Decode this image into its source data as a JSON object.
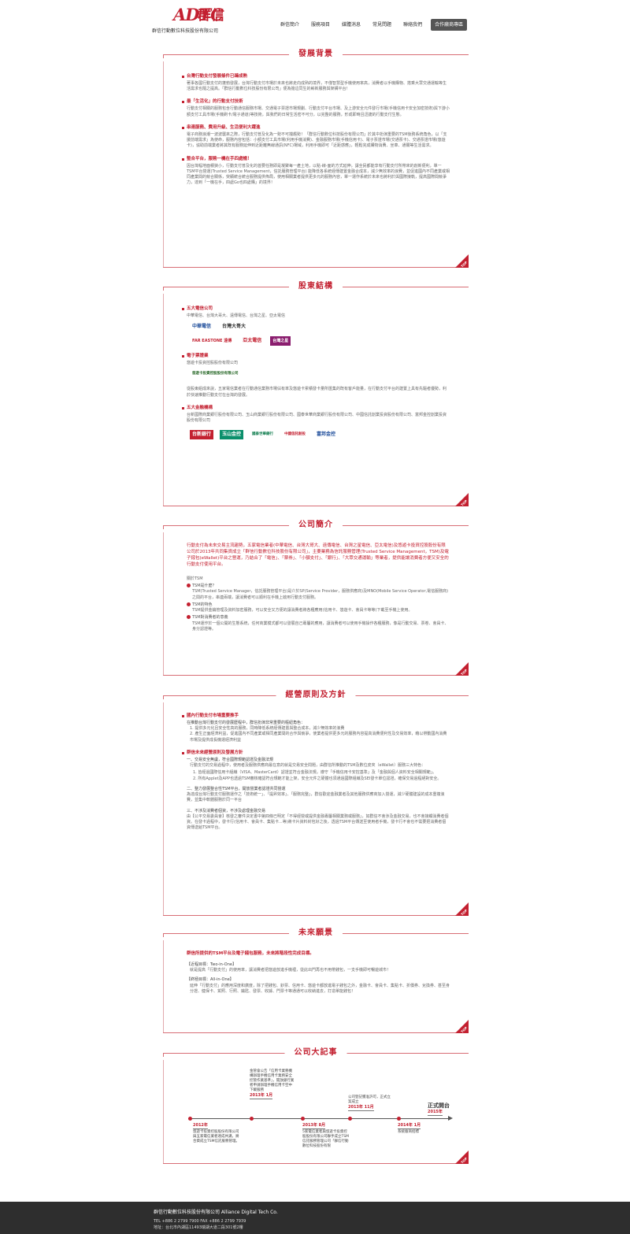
{
  "header": {
    "logo_brand": "ADTC",
    "logo_cn": "群信",
    "logo_dtc": "DTC",
    "company_name": "群信行動數位科技股份有限公司"
  },
  "nav": [
    "群信簡介",
    "服務項目",
    "媒體消息",
    "常見問題",
    "聯絡我們",
    "合作廠商專區"
  ],
  "sections": {
    "background": {
      "title": "發展背景",
      "items": [
        {
          "h": "台灣行動支付發展條件已臻成熟",
          "p": "著事各國行動支付的蓬勃發展，台灣行動支付市場於未來也將走向成熟的境界，不僅智慧型手機使用率高，消費者以手機購物、搭乘大眾交通運輸等生活需求也隨之提高。「群信行動數位科技股份有限公司」便為擔這同生的嶄新服務與架構平台！"
        },
        {
          "h": "最「生活化」的行動支付技術",
          "p": "行動支付相關的服務包含行動通信服務市場、交通電子票證市場規劃、行動支付平台市場、及上游安全元件發行市場(手機信用卡安全加密技術)與下游小額支付工具市場(手機刷卡/電子通道)等技術，與我們的日常生活密不可分，以完整的服務，形成即時且迅捷的行動支付生態。"
        },
        {
          "h": "串連服務、費用升級、生活便利大躍進",
          "p": "電子商務浪潮一波波襲來之際，行動支付普及化為一勢不可擋趨勢！「群信行動數位科技股份有限公司」於其中扮演重要的TSM後務系統角色，以「支援前端需求」為使命，服務內容包括：小額支付工具市場(利用手機消費)、金融服務市場(手機信用卡)、電子票證市場(交通票卡)、交通票證市場(悠遊卡)，協助前端業者將其既有服務延伸到近距離無線通訊(NFC)場域，利用手機即可「近距感應」，輕鬆完成購物消費、坐車、通關等生活需求。"
        },
        {
          "h": "整合平台，服務一機在手四處暢！",
          "p": "因台灣幅地面積狹小，行動支付普及化的首要任務即是凝聚每一產土地，以點-線-面的方式延伸，讓全民都能享有行動支付所帶來的創新便利，單一TSM平台營運(Trusted Service Management，信託服務管理平台) 能降低各系統經傳建置金融合成本，減少無效率的浪費，並促進國內不同產業或相同產業間的競合關係，突顯統合統合服務提供佈局，使用相關業者提供更多元的服務內容，單一運作系統於未來也將利於與國際接軌，提高國際間競爭力，達到「一機在手，四處Go也四處購」的境界！"
        }
      ]
    },
    "shareholders": {
      "title": "股東結構",
      "groups": [
        {
          "h": "五大電信公司",
          "p": "中華電信、台灣大哥大、遠傳電信、台灣之星、亞太電信",
          "logos": [
            "中華電信",
            "台灣大哥大",
            "FAR EASTONE 遠傳",
            "亞太電信",
            "台灣之星"
          ]
        },
        {
          "h": "電子票證業",
          "p": "悠遊卡投資控股股份有限公司",
          "logos": [
            "悠遊卡投資控股股份有限公司"
          ],
          "note": "從股東組成來說，五家電信業者在行動通信業務市場佔有率及悠遊卡累積發卡量所匯集的既有客戶能量，在行動支付平台的建置上具有先驅者優勢，利於快速推動行動支付在台灣的發展。"
        },
        {
          "h": "五大金融機構",
          "p": "台新國際商業銀行股份有限公司、玉山商業銀行股份有限公司、國泰世華商業銀行股份有限公司、中國信託創業投資股份有限公司、富邦金控創業投資股份有限公司",
          "logos": [
            "台新銀行",
            "玉山金控",
            "國泰世華銀行",
            "中國信託創投",
            "富邦金控"
          ]
        }
      ]
    },
    "profile": {
      "title": "公司簡介",
      "intro": "行動支付為未來交易主流趨勢，五家電信業者(中華電信、台灣大哥大、遠傳電信、台灣之星電信、亞太電信)及悠遊卡投資控股股份有限公司於2013年共同集資成立「群信行動數位科技股份有限公司」，主要業務為信託服務管理(Trusted Service Management，TSM)及電子錢包(eWallet)平台之營運，乃結合了「電信」、「票券」、「小額支付」、「銀行」、「大眾交通運輸」等業者，提供能讓消費者方便又安全的行動支付使用平台。",
      "label": "關於TSM",
      "qa": [
        {
          "q": "TSM是什麼？",
          "a": "TSM(Trusted Service Manager，信託服務管理平台)是介於SP(Service Provider，服務供應商)及MNO(Mobile Service Operator,電信服務商)之間的平台，串連兩端，讓消費者可以順利在手機上啟用行動支付服務。"
        },
        {
          "q": "TSM的特色",
          "a": "TSM提供金鑰管理及資料加密服務，可以安全又方便的讓消費者將各種應用(信用卡、悠遊卡、會員卡等等)下載至手機上使用。"
        },
        {
          "q": "TSM對消費者的意義",
          "a": "TSM運作於一個公開的生態系統，任何商業模式都可以發展自己專屬的應用，讓消費者可以使用手機操作各種服務，像是行動交易、票卷、會員卡、身分認證等。"
        }
      ]
    },
    "principles": {
      "title": "經營原則及方針",
      "h1": "國內行動支付市場重要推手",
      "p1": "在推動台灣行動支付的發展歷程中，群信扮演非常重要的樞紐角色：",
      "l1": [
        "1. 提供多元化且安全性高的服務，同時降低系統經傳建置與整合成本，減少無效率的浪費",
        "2. 產生正面經濟利益，促進國內不同產業或相同產業間的合作與競爭，使業者提供更多元的服務內容提高消費便利性及交易效率，藉以帶動國內消費市場及提供成長機運經濟利益"
      ],
      "h2": "群信未來經營原則及發展方針",
      "s1": "一、交易安全無虞，符合國際規範認證及金融法規",
      "p2": "行動支付的交易過程中，使用者及服務供應商最在意的就是交易安全問題，由群信所推動的TSM及數位皮夾（eWallet）服務三大特色：",
      "l2": [
        "1. 皆經過國際信用卡組織（VISA、MasterCard）認證並符合金融法規，遵守「手機信用卡安控基準」及「金融與個人資料安全相關規範」。",
        "2. 所有Applet及APP也透過TSM審核確認符合規範才能上架，安全元件之硬體也須通過國際組織及SEI發卡單位認證，確保交易過程絕對安全。"
      ],
      "s2": "二、整力發展整合性TSM平台，開放營業者認證共同營運",
      "p3": "為達成台灣行動支付服務運作之「技術統一」、「提昇效率」、「服務完整」，群信歡迎金融業者及其他服務供應商加入營運，減少硬體建設的成本重複浪費，並集中軟體服務於同一平台",
      "s3": "三、不涉及消費者個資，不涉及處理金融交易",
      "p4": "由【公平交易委員會】核發之審件決定書中第四條已明定「不得經營或提供金融專屬相關業務或服務」，如群信不會涉及金融交易，也不會接觸消費者個資。在發卡過程中，發卡行(信用卡、會員卡、集點卡...等)將卡片資料封包好之後，透過TSM平台傳送至使用者手機，發卡行不會也不需要把消費者個資傳送給TSM平台。"
    },
    "future": {
      "title": "未來願景",
      "intro": "群信所提供的TSM平台及電子錢包服務，未來將階段性完成目標。",
      "n1": "【近程目標：Two-in-One】",
      "p1": "就是提高「行動支付」的使用率，讓消費者把悠遊放進手機裡，從此出門再也不用帶錢包，一支手機即可暢遊城市！",
      "n2": "【終極目標：All-in-One】",
      "p2": "延伸「行動支付」的應用深度和廣度，除了把錢包、鈔票、信用卡、悠遊卡都放進電子錢包之外，金融卡、會員卡、集點卡、折價券、兌換券、甚至身分證、健保卡、駕照、行照、鑰匙、發票、收據、門票卡等通通可以收納進去，打造單能錢包！"
    },
    "history": {
      "title": "公司大記事",
      "events": [
        {
          "year": "2012年",
          "text": "悠遊卡投資控股股份有限公司與五家電信業者達成共識，將合資成立TSM信託服務管理。"
        },
        {
          "year": "2013年 1月",
          "text": "金管會公告「信用卡業務機構辦理手機信用卡業務安全控管作業基準」，開放銀行業者申請辦理手機信用卡空中下載服務"
        },
        {
          "year": "2013年 8月",
          "text": "5家電信業者與悠遊卡投資控股股份有限公司聯手成立TSM信託服務管理公司「群信行動數位科技股份有限"
        },
        {
          "year": "2013年 11月",
          "text": "公司登記獲准許可，正式立案成立"
        },
        {
          "year": "2014年 1月",
          "text": "系統廠商招標"
        },
        {
          "year": "2015年",
          "text": "正式開台"
        }
      ]
    }
  },
  "top_label": "TOP",
  "footer": {
    "name": "群信行動數位科技股份有限公司 Alliance Digital Tech Co.",
    "tel": "TEL +886 2 2799 7900 FAX +886 2 2799 7939",
    "addr": "地址：台北市內湖區11493瑞湖大道二段301號2樓"
  }
}
